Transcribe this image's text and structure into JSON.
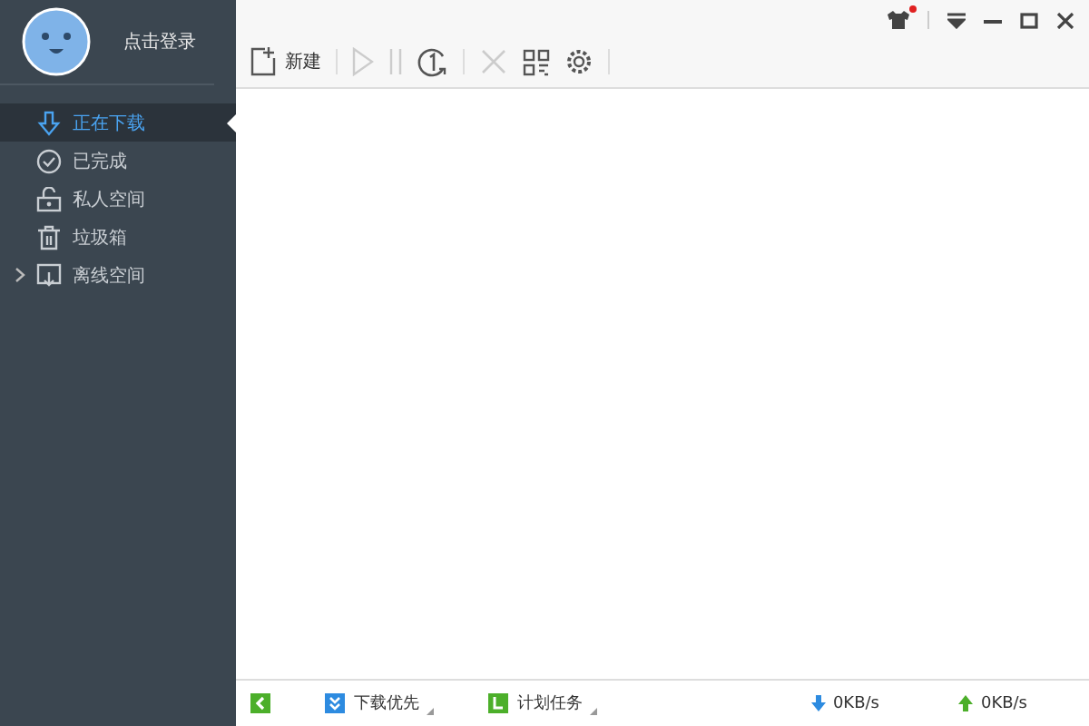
{
  "user": {
    "login_label": "点击登录"
  },
  "nav": [
    {
      "label": "正在下载",
      "kind": "downloading",
      "selected": true
    },
    {
      "label": "已完成",
      "kind": "completed",
      "selected": false
    },
    {
      "label": "私人空间",
      "kind": "private",
      "selected": false
    },
    {
      "label": "垃圾箱",
      "kind": "trash",
      "selected": false
    },
    {
      "label": "离线空间",
      "kind": "offline",
      "selected": false,
      "expanded": false
    }
  ],
  "toolbar": {
    "new_label": "新建"
  },
  "status_bar": {
    "priority_label": "下载优先",
    "schedule_label": "计划任务",
    "download_speed": "0KB/s",
    "upload_speed": "0KB/s"
  }
}
